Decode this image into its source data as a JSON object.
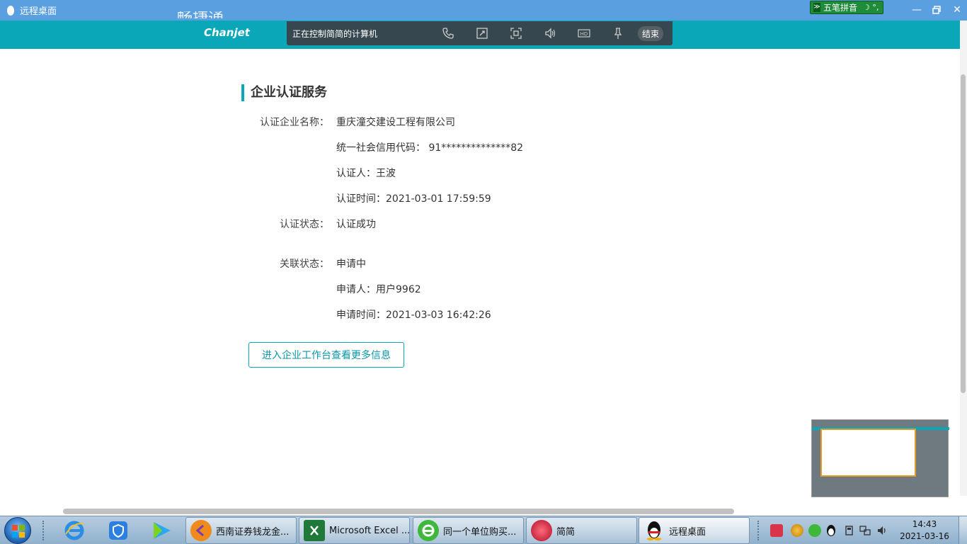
{
  "window": {
    "title": "远程桌面"
  },
  "ime": {
    "label": "五笔拼音",
    "extra": "☽ °,"
  },
  "header": {
    "brand_cn": "畅捷通",
    "brand_en": "Chanjet"
  },
  "remote_bar": {
    "status": "正在控制简简的计算机",
    "end_label": "结束",
    "hd_label": "HD"
  },
  "section": {
    "title": "企业认证服务",
    "company_label": "认证企业名称：",
    "company_name": "重庆潼交建设工程有限公司",
    "credit_code": "统一社会信用代码： 91**************82",
    "certifier": "认证人：王波",
    "cert_time": "认证时间：2021-03-01 17:59:59",
    "status_label": "认证状态：",
    "status_value": "认证成功",
    "link_label": "关联状态：",
    "link_value": "申请中",
    "applicant": "申请人：用户9962",
    "apply_time": "申请时间：2021-03-03 16:42:26",
    "cta": "进入企业工作台查看更多信息"
  },
  "taskbar": {
    "tasks": [
      {
        "label": "西南证券钱龙金...",
        "icon": "qianlong-icon",
        "color": "#f08a1c"
      },
      {
        "label": "Microsoft Excel ...",
        "icon": "excel-icon",
        "color": "#1f7a3a"
      },
      {
        "label": "同一个单位购买...",
        "icon": "browser-icon",
        "color": "#3db83a"
      },
      {
        "label": "简简",
        "icon": "flower-avatar-icon",
        "color": "#d0243a"
      },
      {
        "label": "远程桌面",
        "icon": "qq-icon",
        "color": "#111111"
      }
    ],
    "clock_time": "14:43",
    "clock_date": "2021-03-16"
  }
}
